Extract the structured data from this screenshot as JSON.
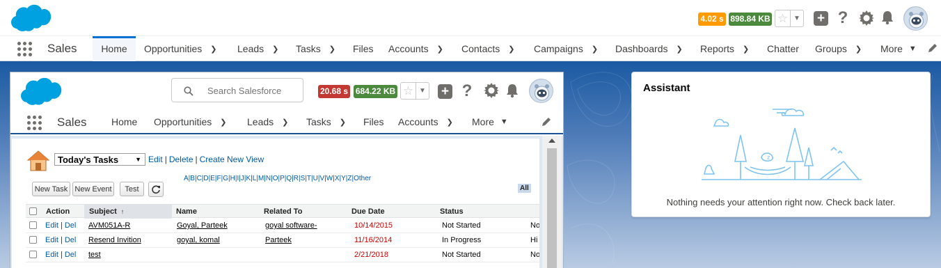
{
  "outer": {
    "app_name": "Sales",
    "perf_time": "4.02 s",
    "perf_size": "898.84 KB",
    "nav": [
      {
        "label": "Home",
        "dropdown": false,
        "active": true
      },
      {
        "label": "Opportunities",
        "dropdown": true
      },
      {
        "label": "Leads",
        "dropdown": true
      },
      {
        "label": "Tasks",
        "dropdown": true
      },
      {
        "label": "Files",
        "dropdown": false
      },
      {
        "label": "Accounts",
        "dropdown": true
      },
      {
        "label": "Contacts",
        "dropdown": true
      },
      {
        "label": "Campaigns",
        "dropdown": true
      },
      {
        "label": "Dashboards",
        "dropdown": true
      },
      {
        "label": "Reports",
        "dropdown": true
      },
      {
        "label": "Chatter",
        "dropdown": false
      },
      {
        "label": "Groups",
        "dropdown": true
      },
      {
        "label": "More",
        "dropdown": true
      }
    ]
  },
  "inner": {
    "app_name": "Sales",
    "search_placeholder": "Search Salesforce",
    "perf_time": "20.68 s",
    "perf_size": "684.22 KB",
    "nav": [
      {
        "label": "Home",
        "dropdown": false
      },
      {
        "label": "Opportunities",
        "dropdown": true
      },
      {
        "label": "Leads",
        "dropdown": true
      },
      {
        "label": "Tasks",
        "dropdown": true
      },
      {
        "label": "Files",
        "dropdown": false
      },
      {
        "label": "Accounts",
        "dropdown": true
      },
      {
        "label": "More",
        "dropdown": true
      }
    ]
  },
  "classic": {
    "view_selected": "Today's Tasks",
    "links": {
      "edit": "Edit",
      "delete": "Delete",
      "create": "Create New View"
    },
    "buttons": {
      "new_task": "New Task",
      "new_event": "New Event",
      "test": "Test"
    },
    "alphabet": [
      "A",
      "B",
      "C",
      "D",
      "E",
      "F",
      "G",
      "H",
      "I",
      "J",
      "K",
      "L",
      "M",
      "N",
      "O",
      "P",
      "Q",
      "R",
      "S",
      "T",
      "U",
      "V",
      "W",
      "X",
      "Y",
      "Z",
      "Other"
    ],
    "alphabet_all": "All",
    "columns": {
      "action": "Action",
      "subject": "Subject",
      "sort_arrow": "↑",
      "name": "Name",
      "related": "Related To",
      "due": "Due Date",
      "status": "Status"
    },
    "action_edit": "Edit",
    "action_del": "Del",
    "rows": [
      {
        "subject": "AVM051A-R",
        "name": "Goyal, Parteek",
        "related": "goyal software-",
        "due": "10/14/2015",
        "status": "Not Started",
        "extra": "No"
      },
      {
        "subject": "Resend Invition",
        "name": "goyal, komal",
        "related": "Parteek",
        "due": "11/16/2014",
        "status": "In Progress",
        "extra": "Hi"
      },
      {
        "subject": "test",
        "name": "",
        "related": "",
        "due": "2/21/2018",
        "status": "Not Started",
        "extra": "No"
      }
    ]
  },
  "assistant": {
    "title": "Assistant",
    "message": "Nothing needs your attention right now. Check back later."
  },
  "colors": {
    "brand_blue": "#00a1e0",
    "nav_accent": "#0070d2",
    "perf_time_badge": "#ff9a00",
    "perf_time_badge_inner": "#c23934",
    "perf_size_badge": "#4b8a3c",
    "background_blue": "#1c5ea8"
  }
}
